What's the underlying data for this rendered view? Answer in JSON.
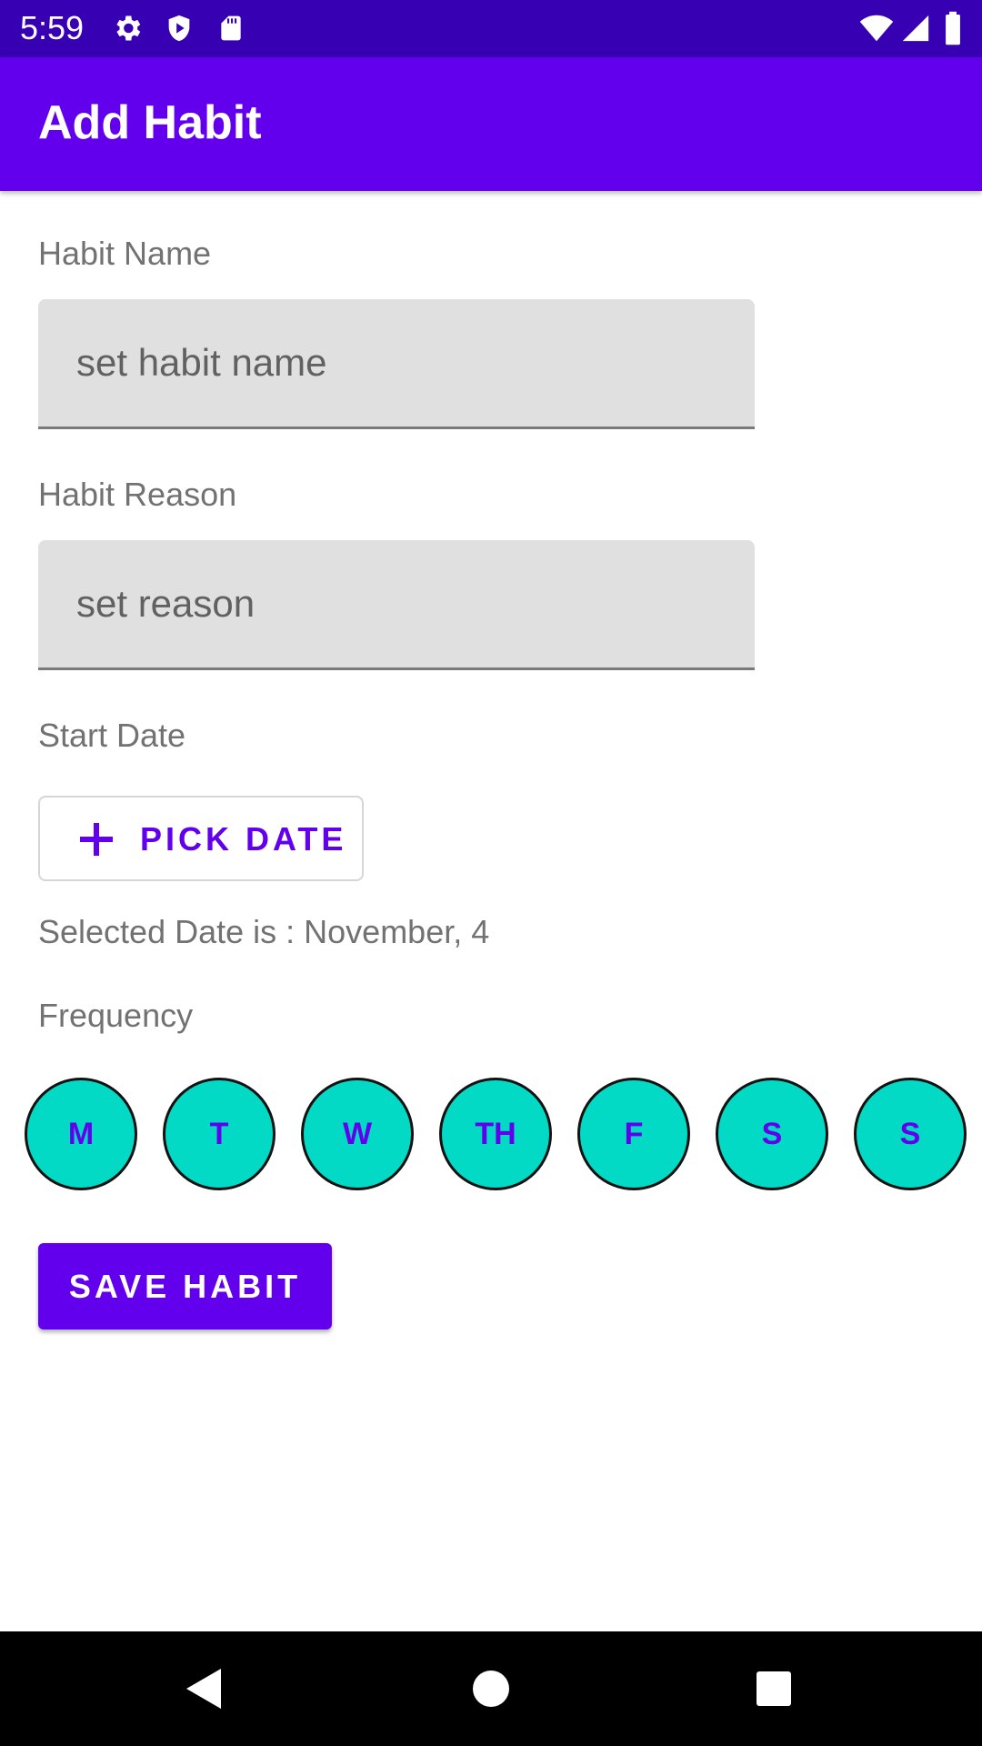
{
  "status_bar": {
    "time": "5:59",
    "left_icons": [
      "gear-icon",
      "shield-icon",
      "sd-card-icon"
    ],
    "right_icons": [
      "wifi-icon",
      "signal-icon",
      "battery-icon"
    ]
  },
  "app_bar": {
    "title": "Add Habit",
    "color": "#6200ee"
  },
  "form": {
    "habit_name": {
      "label": "Habit Name",
      "placeholder": "set habit name",
      "value": ""
    },
    "habit_reason": {
      "label": "Habit Reason",
      "placeholder": "set reason",
      "value": ""
    },
    "start_date": {
      "label": "Start Date",
      "button_label": "PICK DATE",
      "selected_text": "Selected Date is : November, 4"
    },
    "frequency": {
      "label": "Frequency",
      "days": [
        "M",
        "T",
        "W",
        "TH",
        "F",
        "S",
        "S"
      ],
      "day_color": "#03dac5"
    },
    "save_label": "SAVE HABIT"
  },
  "nav_bar": {
    "buttons": [
      "back-icon",
      "home-icon",
      "recents-icon"
    ]
  }
}
